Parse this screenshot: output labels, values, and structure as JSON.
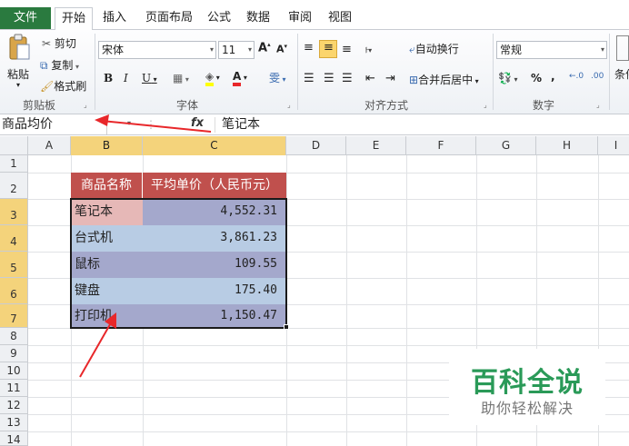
{
  "tabs": {
    "file": "文件",
    "home": "开始",
    "insert": "插入",
    "page_layout": "页面布局",
    "formulas": "公式",
    "data": "数据",
    "review": "审阅",
    "view": "视图"
  },
  "ribbon": {
    "clipboard": {
      "paste": "粘贴",
      "cut": "剪切",
      "copy": "复制",
      "format_painter": "格式刷",
      "label": "剪贴板"
    },
    "font": {
      "font_name": "宋体",
      "font_size": "11",
      "label": "字体"
    },
    "alignment": {
      "wrap_text": "自动换行",
      "merge_center": "合并后居中",
      "label": "对齐方式"
    },
    "number": {
      "format": "常规",
      "label": "数字",
      "percent": "%",
      "comma": ","
    },
    "conditional": "条件"
  },
  "formula_bar": {
    "name_box": "商品均价",
    "fx": "fx",
    "content": "笔记本"
  },
  "columns": [
    "A",
    "B",
    "C",
    "D",
    "E",
    "F",
    "G",
    "H",
    "I"
  ],
  "rows": [
    "1",
    "2",
    "3",
    "4",
    "5",
    "6",
    "7",
    "8",
    "9",
    "10",
    "11",
    "12",
    "13",
    "14"
  ],
  "table": {
    "headers": [
      "商品名称",
      "平均单价（人民币元）"
    ],
    "rows": [
      {
        "name": "笔记本",
        "price": "4,552.31"
      },
      {
        "name": "台式机",
        "price": "3,861.23"
      },
      {
        "name": "鼠标",
        "price": "109.55"
      },
      {
        "name": "键盘",
        "price": "175.40"
      },
      {
        "name": "打印机",
        "price": "1,150.47"
      }
    ]
  },
  "colors": {
    "header_fill": "#c0504d",
    "first_cell_fill": "#e6b8b7",
    "row_light": "#b8cce4",
    "row_dark": "#a4a8cc",
    "selected_header": "#f4d37b",
    "file_tab": "#2a7a3f",
    "arrow": "#e8272a",
    "watermark": "#2a9a58"
  },
  "watermark": {
    "title": "百科全说",
    "subtitle": "助你轻松解决"
  }
}
